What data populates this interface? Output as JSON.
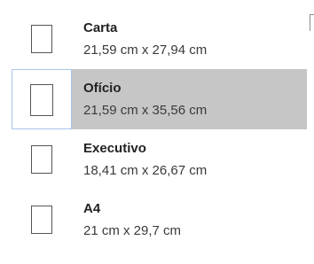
{
  "paper_sizes": [
    {
      "name": "Carta",
      "dimensions": "21,59 cm x 27,94 cm",
      "selected": false
    },
    {
      "name": "Ofício",
      "dimensions": "21,59 cm x 35,56 cm",
      "selected": true
    },
    {
      "name": "Executivo",
      "dimensions": "18,41 cm x 26,67 cm",
      "selected": false
    },
    {
      "name": "A4",
      "dimensions": "21 cm x 29,7 cm",
      "selected": false
    }
  ],
  "colors": {
    "selected_background": "#c6c6c6",
    "selected_thumb_outline": "#a9c5e8"
  },
  "icons": {
    "page_thumbnail": "page-thumbnail-icon"
  }
}
